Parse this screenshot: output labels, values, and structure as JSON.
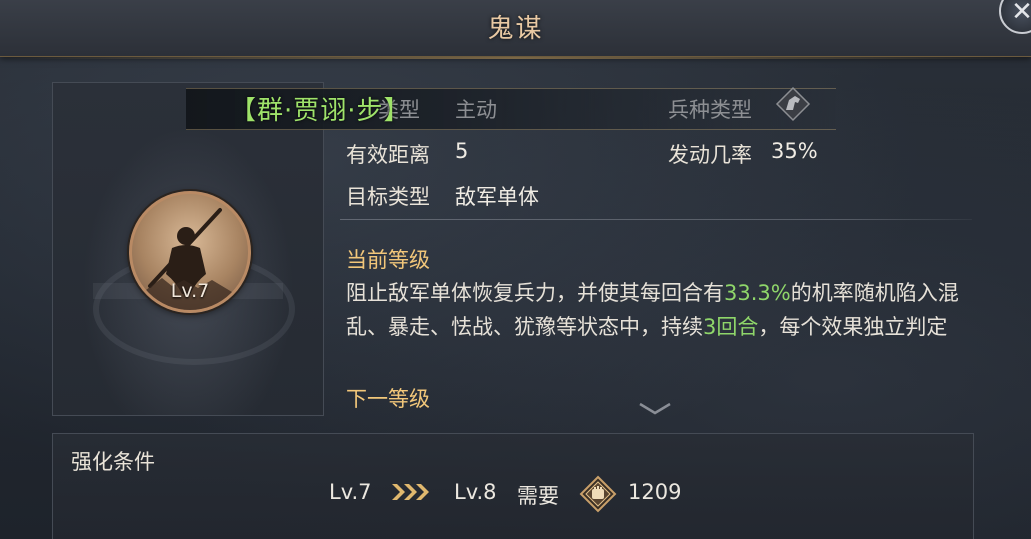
{
  "window": {
    "title": "鬼谋",
    "close_icon": "close-x-icon"
  },
  "skill": {
    "level_badge": "Lv.7",
    "faction_label": "【群·贾诩·步】"
  },
  "info": {
    "tactic_type_label": "类型",
    "tactic_type_value": "主动",
    "troop_type_label": "兵种类型",
    "range_label": "有效距离",
    "range_value": "5",
    "trigger_rate_label": "发动几率",
    "trigger_rate_value": "35%",
    "target_label": "目标类型",
    "target_value": "敌军单体"
  },
  "description": {
    "current_level_heading": "当前等级",
    "text_part1": "阻止敌军单体恢复兵力，并使其每回合有",
    "highlight_chance": "33.3%",
    "text_part2": "的机率随机陷入混乱、暴走、怯战、犹豫等状态中，持续",
    "highlight_duration": "3回合",
    "text_part3": "，每个效果独立判定",
    "next_level_heading": "下一等级"
  },
  "enhance": {
    "title": "强化条件",
    "from_level": "Lv.7",
    "to_level": "Lv.8",
    "require_label": "需要",
    "cost": "1209"
  },
  "colors": {
    "title_gold": "#e9c9a3",
    "faction_green": "#9fe36a",
    "heading_gold": "#f2c77a",
    "highlight_green": "#8fd66a"
  }
}
